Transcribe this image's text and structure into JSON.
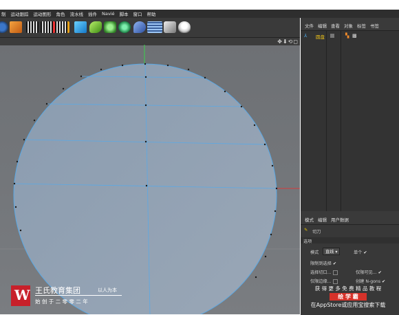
{
  "menubar": {
    "items": [
      "制",
      "运动跟踪",
      "运动图形",
      "角色",
      "流水线",
      "插件",
      "Navié",
      "脚本",
      "窗口",
      "帮助"
    ]
  },
  "object_manager": {
    "tabs": [
      "文件",
      "编辑",
      "查看",
      "对象",
      "标签",
      "书签"
    ],
    "object_name": "圆盘"
  },
  "attribute_manager": {
    "tabs": [
      "模式",
      "编辑",
      "用户数据"
    ],
    "tool_name": "切刀",
    "section": "选项",
    "mode_label": "模式",
    "mode_value": "直线",
    "single_label": "单个",
    "restrict_label": "限制到选择",
    "select_cut_label": "选择切口...",
    "only_visible_label": "仅限可见...",
    "only_edge_label": "仅限边缘...",
    "create_ngons_label": "创建 N-gons"
  },
  "logo": {
    "company": "王氏教育集团",
    "slogan": "以人为本",
    "founded": "始 创 于 二 零 零 二 年"
  },
  "watermark": {
    "line1": "获 得 更 多 免 费 精 品 教 程",
    "brand": "绘 学 霸",
    "line3": "在AppStore或应用宝搜索下载"
  },
  "colors": {
    "accent": "#5aa9e6",
    "logo_red": "#c8202a",
    "yellow_check": "#e5c200"
  }
}
